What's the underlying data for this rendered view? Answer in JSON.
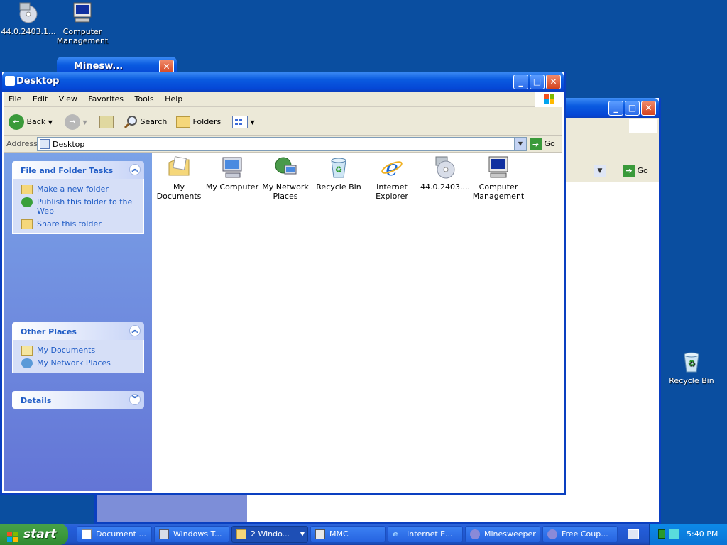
{
  "desktop_icons": [
    {
      "label": "44.0.2403.1...",
      "icon": "cd-icon"
    },
    {
      "label": "Computer Management",
      "icon": "computer-management-icon"
    },
    {
      "label": "Recycle Bin",
      "icon": "recycle-bin-icon"
    }
  ],
  "bg_window": {
    "title": "Minesweeper",
    "title_clipped": "Minesw..."
  },
  "back_window": {
    "go_label": "Go"
  },
  "explorer": {
    "title": "Desktop",
    "menu": [
      "File",
      "Edit",
      "View",
      "Favorites",
      "Tools",
      "Help"
    ],
    "toolbar": {
      "back": "Back",
      "search": "Search",
      "folders": "Folders"
    },
    "address": {
      "label": "Address",
      "value": "Desktop",
      "go": "Go"
    },
    "panels": {
      "tasks": {
        "title": "File and Folder Tasks",
        "items": [
          "Make a new folder",
          "Publish this folder to the Web",
          "Share this folder"
        ]
      },
      "places": {
        "title": "Other Places",
        "items": [
          "My Documents",
          "My Network Places"
        ]
      },
      "details": {
        "title": "Details"
      }
    },
    "items": [
      {
        "label": "My Documents",
        "icon": "my-documents-icon"
      },
      {
        "label": "My Computer",
        "icon": "my-computer-icon"
      },
      {
        "label": "My Network Places",
        "icon": "network-places-icon"
      },
      {
        "label": "Recycle Bin",
        "icon": "recycle-bin-icon"
      },
      {
        "label": "Internet Explorer",
        "icon": "internet-explorer-icon"
      },
      {
        "label": "44.0.2403....",
        "icon": "cd-icon"
      },
      {
        "label": "Computer Management",
        "icon": "computer-management-icon"
      }
    ]
  },
  "taskbar": {
    "start": "start",
    "buttons": [
      "Document ...",
      "Windows T...",
      "2 Windo...",
      "MMC",
      "Internet E...",
      "Minesweeper",
      "Free Coup..."
    ],
    "clock": "5:40 PM"
  },
  "colors": {
    "desktop": "#0a4ea0",
    "titlebar": "#0547d6",
    "start": "#3c9a3d",
    "link": "#215dc6"
  }
}
